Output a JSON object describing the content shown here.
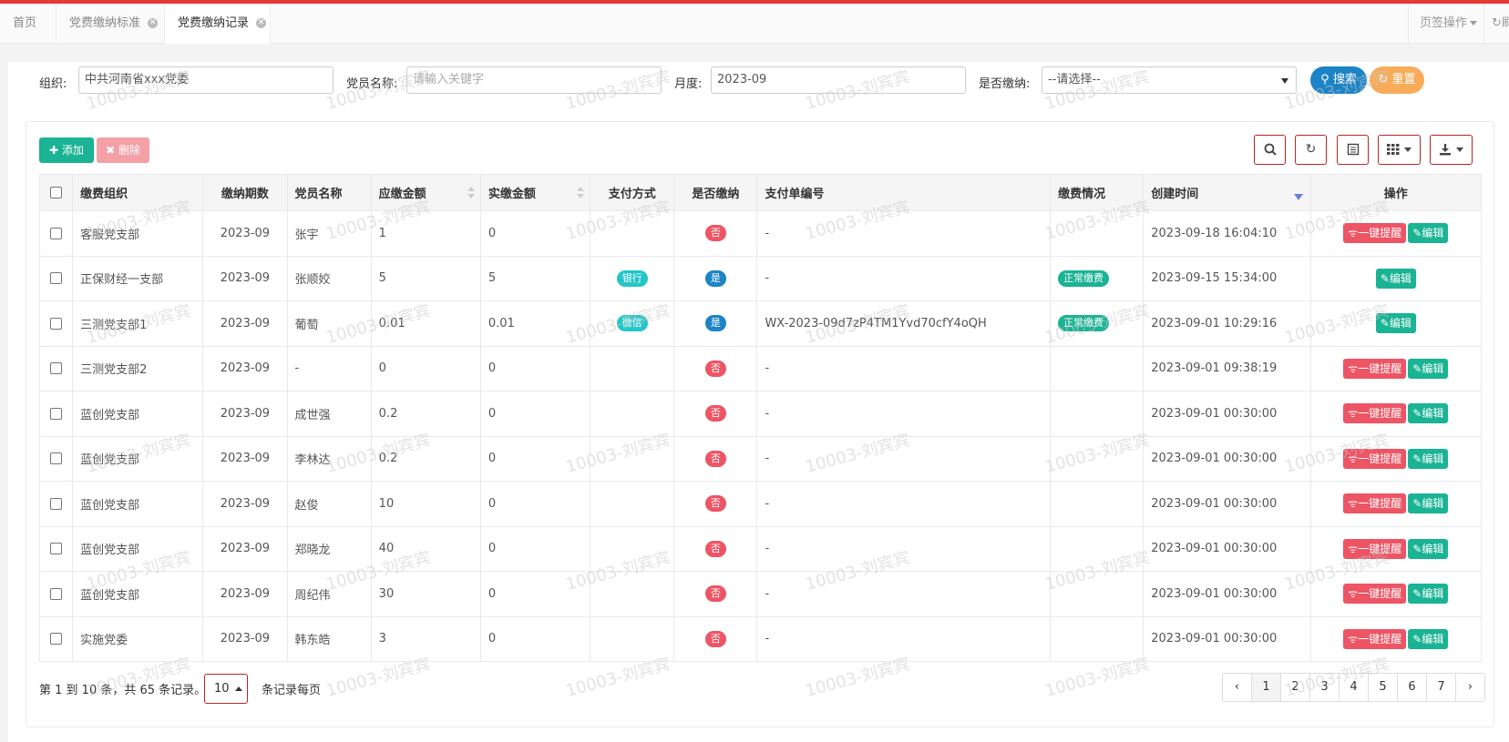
{
  "tabs": [
    {
      "label": "首页",
      "closable": false,
      "active": false
    },
    {
      "label": "党费缴纳标准",
      "closable": true,
      "active": false
    },
    {
      "label": "党费缴纳记录",
      "closable": true,
      "active": true
    }
  ],
  "page_ops_label": "页签操作",
  "refresh_label": "刷新",
  "filters": {
    "org_label": "组织:",
    "org_value": "中共河南省xxx党委",
    "member_label": "党员名称:",
    "member_placeholder": "请输入关键字",
    "month_label": "月度:",
    "month_value": "2023-09",
    "paid_label": "是否缴纳:",
    "paid_value": "--请选择--",
    "search_btn": "搜索",
    "reset_btn": "重置"
  },
  "toolbar": {
    "add_label": "添加",
    "delete_label": "删除"
  },
  "table": {
    "headers": {
      "org": "缴费组织",
      "period": "缴纳期数",
      "member": "党员名称",
      "due": "应缴金额",
      "paid_amount": "实缴金额",
      "method": "支付方式",
      "is_paid": "是否缴纳",
      "order_no": "支付单编号",
      "status": "缴费情况",
      "created": "创建时间",
      "actions": "操作"
    },
    "rows": [
      {
        "org": "客服党支部",
        "period": "2023-09",
        "member": "张宇",
        "due": "1",
        "paid_amount": "0",
        "method": "",
        "is_paid": "否",
        "order_no": "-",
        "status": "",
        "created": "2023-09-18 16:04:10",
        "remind": "一键提醒",
        "edit": "编辑"
      },
      {
        "org": "正保财经一支部",
        "period": "2023-09",
        "member": "张顺姣",
        "due": "5",
        "paid_amount": "5",
        "method": "银行",
        "is_paid": "是",
        "order_no": "-",
        "status": "正常缴费",
        "created": "2023-09-15 15:34:00",
        "remind": "",
        "edit": "编辑"
      },
      {
        "org": "三测党支部1",
        "period": "2023-09",
        "member": "葡萄",
        "due": "0.01",
        "paid_amount": "0.01",
        "method": "微信",
        "is_paid": "是",
        "order_no": "WX-2023-09d7zP4TM1Yvd70cfY4oQH",
        "status": "正常缴费",
        "created": "2023-09-01 10:29:16",
        "remind": "",
        "edit": "编辑"
      },
      {
        "org": "三测党支部2",
        "period": "2023-09",
        "member": "-",
        "due": "0",
        "paid_amount": "0",
        "method": "",
        "is_paid": "否",
        "order_no": "-",
        "status": "",
        "created": "2023-09-01 09:38:19",
        "remind": "一键提醒",
        "edit": "编辑"
      },
      {
        "org": "蓝创党支部",
        "period": "2023-09",
        "member": "成世强",
        "due": "0.2",
        "paid_amount": "0",
        "method": "",
        "is_paid": "否",
        "order_no": "-",
        "status": "",
        "created": "2023-09-01 00:30:00",
        "remind": "一键提醒",
        "edit": "编辑"
      },
      {
        "org": "蓝创党支部",
        "period": "2023-09",
        "member": "李林达",
        "due": "0.2",
        "paid_amount": "0",
        "method": "",
        "is_paid": "否",
        "order_no": "-",
        "status": "",
        "created": "2023-09-01 00:30:00",
        "remind": "一键提醒",
        "edit": "编辑"
      },
      {
        "org": "蓝创党支部",
        "period": "2023-09",
        "member": "赵俊",
        "due": "10",
        "paid_amount": "0",
        "method": "",
        "is_paid": "否",
        "order_no": "-",
        "status": "",
        "created": "2023-09-01 00:30:00",
        "remind": "一键提醒",
        "edit": "编辑"
      },
      {
        "org": "蓝创党支部",
        "period": "2023-09",
        "member": "郑晓龙",
        "due": "40",
        "paid_amount": "0",
        "method": "",
        "is_paid": "否",
        "order_no": "-",
        "status": "",
        "created": "2023-09-01 00:30:00",
        "remind": "一键提醒",
        "edit": "编辑"
      },
      {
        "org": "蓝创党支部",
        "period": "2023-09",
        "member": "周纪伟",
        "due": "30",
        "paid_amount": "0",
        "method": "",
        "is_paid": "否",
        "order_no": "-",
        "status": "",
        "created": "2023-09-01 00:30:00",
        "remind": "一键提醒",
        "edit": "编辑"
      },
      {
        "org": "实施党委",
        "period": "2023-09",
        "member": "韩东皓",
        "due": "3",
        "paid_amount": "0",
        "method": "",
        "is_paid": "否",
        "order_no": "-",
        "status": "",
        "created": "2023-09-01 00:30:00",
        "remind": "一键提醒",
        "edit": "编辑"
      }
    ]
  },
  "pager": {
    "info": "第 1 到 10 条，共 65 条记录。",
    "page_size": "10",
    "per_page_label": "条记录每页",
    "prev": "‹",
    "next": "›",
    "pages": [
      "1",
      "2",
      "3",
      "4",
      "5",
      "6",
      "7"
    ],
    "current": "1"
  },
  "watermark": "10003-刘宾宾",
  "colors": {
    "accent_red": "#ed5565",
    "blue": "#1c84c6",
    "green": "#1ab394",
    "cyan": "#23c6c8",
    "orange": "#f8ac59",
    "top_bar": "#e53935"
  }
}
